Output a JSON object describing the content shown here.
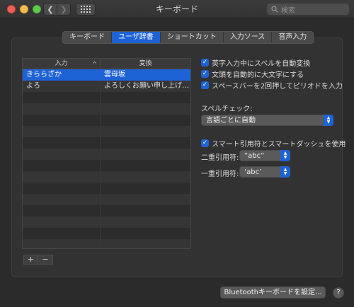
{
  "window": {
    "title": "キーボード",
    "search_placeholder": "検索",
    "back_glyph": "❮",
    "forward_glyph": "❯"
  },
  "tabs": [
    {
      "label": "キーボード",
      "active": false
    },
    {
      "label": "ユーザ辞書",
      "active": true
    },
    {
      "label": "ショートカット",
      "active": false
    },
    {
      "label": "入力ソース",
      "active": false
    },
    {
      "label": "音声入力",
      "active": false
    }
  ],
  "dictionary": {
    "headers": {
      "input": "入力",
      "replace": "変換"
    },
    "sort_indicator": "^",
    "rows": [
      {
        "input": "きららざか",
        "replace": "雲母坂",
        "selected": true
      },
      {
        "input": "よろ",
        "replace": "よろしくお願い申し上げま…",
        "selected": false
      },
      {
        "input": "",
        "replace": "",
        "selected": false
      },
      {
        "input": "",
        "replace": "",
        "selected": false
      },
      {
        "input": "",
        "replace": "",
        "selected": false
      },
      {
        "input": "",
        "replace": "",
        "selected": false
      },
      {
        "input": "",
        "replace": "",
        "selected": false
      },
      {
        "input": "",
        "replace": "",
        "selected": false
      },
      {
        "input": "",
        "replace": "",
        "selected": false
      },
      {
        "input": "",
        "replace": "",
        "selected": false
      },
      {
        "input": "",
        "replace": "",
        "selected": false
      },
      {
        "input": "",
        "replace": "",
        "selected": false
      },
      {
        "input": "",
        "replace": "",
        "selected": false
      },
      {
        "input": "",
        "replace": "",
        "selected": false
      },
      {
        "input": "",
        "replace": "",
        "selected": false
      },
      {
        "input": "",
        "replace": "",
        "selected": false
      }
    ],
    "add_label": "+",
    "remove_label": "−"
  },
  "options": {
    "spell_correct": {
      "label": "英字入力中にスペルを自動変換",
      "checked": true
    },
    "auto_capitalize": {
      "label": "文頭を自動的に大文字にする",
      "checked": true
    },
    "double_space_period": {
      "label": "スペースバーを2回押してピリオドを入力",
      "checked": true
    },
    "spell_check_label": "スペルチェック:",
    "spell_check_value": "言語ごとに自動",
    "smart_quotes": {
      "label": "スマート引用符とスマートダッシュを使用",
      "checked": true
    },
    "double_quote_label": "二重引用符:",
    "double_quote_value": "“abc”",
    "single_quote_label": "一重引用符:",
    "single_quote_value": "‘abc’"
  },
  "footer": {
    "bluetooth_button": "Bluetoothキーボードを設定...",
    "help_label": "?"
  },
  "colors": {
    "accent": "#1e63d6"
  }
}
